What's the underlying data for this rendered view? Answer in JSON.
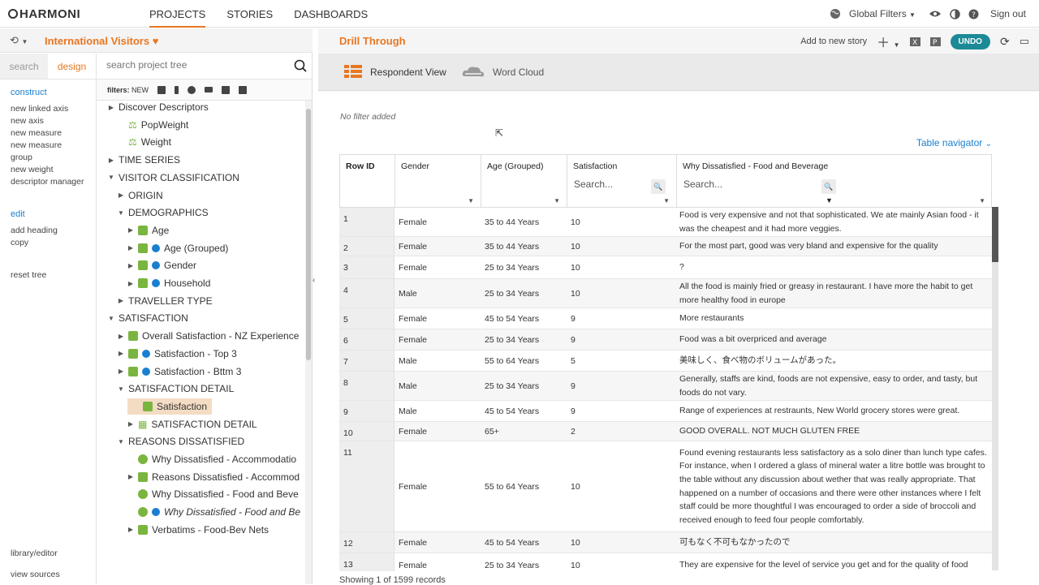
{
  "app": {
    "name": "HARMONI"
  },
  "nav": {
    "items": [
      "PROJECTS",
      "STORIES",
      "DASHBOARDS"
    ],
    "active": "PROJECTS"
  },
  "topright": {
    "global_filters": "Global Filters",
    "sign_out": "Sign out"
  },
  "project": {
    "title": "International Visitors"
  },
  "left_tabs": {
    "search": "search",
    "design": "design"
  },
  "actions": {
    "construct_heading": "construct",
    "construct_links": [
      "new linked axis",
      "new axis",
      "new measure",
      "new measure group",
      "new weight",
      "descriptor manager"
    ],
    "edit_heading": "edit",
    "edit_links": [
      "add heading",
      "copy"
    ],
    "reset": "reset tree",
    "library": "library/editor",
    "view_sources": "view sources"
  },
  "tree_search": {
    "placeholder": "search project tree"
  },
  "filters": {
    "label": "filters:",
    "new": "NEW"
  },
  "tree": [
    {
      "label": "Discover Descriptors",
      "indent": 0,
      "arrow": "▶",
      "icon": ""
    },
    {
      "label": "PopWeight",
      "indent": 1,
      "arrow": "",
      "icon": "weight"
    },
    {
      "label": "Weight",
      "indent": 1,
      "arrow": "",
      "icon": "weight"
    },
    {
      "label": "TIME SERIES",
      "indent": 0,
      "arrow": "▶",
      "icon": ""
    },
    {
      "label": "VISITOR CLASSIFICATION",
      "indent": 0,
      "arrow": "▼",
      "icon": ""
    },
    {
      "label": "ORIGIN",
      "indent": 1,
      "arrow": "▶",
      "icon": ""
    },
    {
      "label": "DEMOGRAPHICS",
      "indent": 1,
      "arrow": "▼",
      "icon": ""
    },
    {
      "label": "Age",
      "indent": 2,
      "arrow": "▶",
      "icon": "green"
    },
    {
      "label": "Age (Grouped)",
      "indent": 2,
      "arrow": "▶",
      "icon": "green-blue"
    },
    {
      "label": "Gender",
      "indent": 2,
      "arrow": "▶",
      "icon": "green-blue"
    },
    {
      "label": "Household",
      "indent": 2,
      "arrow": "▶",
      "icon": "green-blue"
    },
    {
      "label": "TRAVELLER TYPE",
      "indent": 1,
      "arrow": "▶",
      "icon": ""
    },
    {
      "label": "SATISFACTION",
      "indent": 0,
      "arrow": "▼",
      "icon": ""
    },
    {
      "label": "Overall Satisfaction - NZ Experience",
      "indent": 1,
      "arrow": "▶",
      "icon": "green"
    },
    {
      "label": "Satisfaction - Top 3",
      "indent": 1,
      "arrow": "▶",
      "icon": "green-blue"
    },
    {
      "label": "Satisfaction - Bttm 3",
      "indent": 1,
      "arrow": "▶",
      "icon": "green-blue"
    },
    {
      "label": "SATISFACTION DETAIL",
      "indent": 1,
      "arrow": "▼",
      "icon": ""
    },
    {
      "label": "Satisfaction",
      "indent": 2,
      "arrow": "",
      "icon": "green",
      "selected": true
    },
    {
      "label": "SATISFACTION DETAIL",
      "indent": 2,
      "arrow": "▶",
      "icon": "grid"
    },
    {
      "label": "REASONS DISSATISFIED",
      "indent": 1,
      "arrow": "▼",
      "icon": ""
    },
    {
      "label": "Why Dissatisfied - Accommodatio",
      "indent": 2,
      "arrow": "",
      "icon": "chat"
    },
    {
      "label": "Reasons Dissatisfied - Accommod",
      "indent": 2,
      "arrow": "▶",
      "icon": "green"
    },
    {
      "label": "Why Dissatisfied - Food and Beve",
      "indent": 2,
      "arrow": "",
      "icon": "chat"
    },
    {
      "label": "Why Dissatisfied - Food and Be",
      "indent": 2,
      "arrow": "",
      "icon": "chat-blue",
      "italic": true
    },
    {
      "label": "Verbatims - Food-Bev Nets",
      "indent": 2,
      "arrow": "▶",
      "icon": "green"
    }
  ],
  "main": {
    "title": "Drill Through",
    "add_to_story": "Add to new story",
    "undo": "UNDO",
    "views": [
      "Respondent View",
      "Word Cloud"
    ],
    "no_filter": "No filter added",
    "table_navigator": "Table navigator",
    "search_placeholder": "Search...",
    "status": "Showing 1 of 1599 records"
  },
  "table": {
    "headers": [
      "Row ID",
      "Gender",
      "Age (Grouped)",
      "Satisfaction",
      "Why Dissatisfied - Food and Beverage"
    ],
    "rows": [
      {
        "id": "1",
        "gender": "Female",
        "age": "35 to 44 Years",
        "sat": "10",
        "why": "Food is very expensive and not that sophisticated. We ate mainly Asian food - it was the cheapest and it had more veggies."
      },
      {
        "id": "2",
        "gender": "Female",
        "age": "35 to 44 Years",
        "sat": "10",
        "why": "For the most part, good was very bland and expensive for the quality"
      },
      {
        "id": "3",
        "gender": "Female",
        "age": "25 to 34 Years",
        "sat": "10",
        "why": "?"
      },
      {
        "id": "4",
        "gender": "Male",
        "age": "25 to 34 Years",
        "sat": "10",
        "why": "All the food is mainly fried or greasy in restaurant. I have more the habit to get more healthy food in europe"
      },
      {
        "id": "5",
        "gender": "Female",
        "age": "45 to 54 Years",
        "sat": "9",
        "why": "More restaurants"
      },
      {
        "id": "6",
        "gender": "Female",
        "age": "25 to 34 Years",
        "sat": "9",
        "why": "Food was a bit overpriced and average"
      },
      {
        "id": "7",
        "gender": "Male",
        "age": "55 to 64 Years",
        "sat": "5",
        "why": "美味しく、食べ物のボリュームがあった。"
      },
      {
        "id": "8",
        "gender": "Male",
        "age": "25 to 34 Years",
        "sat": "9",
        "why": "Generally, staffs are kind, foods are not expensive, easy to order, and tasty, but foods do not vary."
      },
      {
        "id": "9",
        "gender": "Male",
        "age": "45 to 54 Years",
        "sat": "9",
        "why": "Range of experiences at restraunts, New World grocery stores were great."
      },
      {
        "id": "10",
        "gender": "Female",
        "age": "65+",
        "sat": "2",
        "why": "GOOD OVERALL. NOT MUCH GLUTEN FREE"
      },
      {
        "id": "11",
        "gender": "Female",
        "age": "55 to 64 Years",
        "sat": "10",
        "why": "Found evening restaurants less satisfactory as a solo diner than lunch type cafes. For instance, when I ordered a glass of mineral water a litre bottle was brought to the table without any discussion about wether that was really appropriate. That happened on a number of occasions and there were other instances where I felt staff could be more thoughtful I was encouraged to order a side of broccoli and received enough to feed four people comfortably."
      },
      {
        "id": "12",
        "gender": "Female",
        "age": "45 to 54 Years",
        "sat": "10",
        "why": "可もなく不可もなかったので"
      },
      {
        "id": "13",
        "gender": "Female",
        "age": "25 to 34 Years",
        "sat": "10",
        "why": "They are expensive for the level of service you get and for the quality of food"
      }
    ]
  },
  "colors": {
    "accent": "#e87722",
    "link": "#1a7fd0",
    "undo": "#1b8a96",
    "tree_green": "#7ab540"
  }
}
